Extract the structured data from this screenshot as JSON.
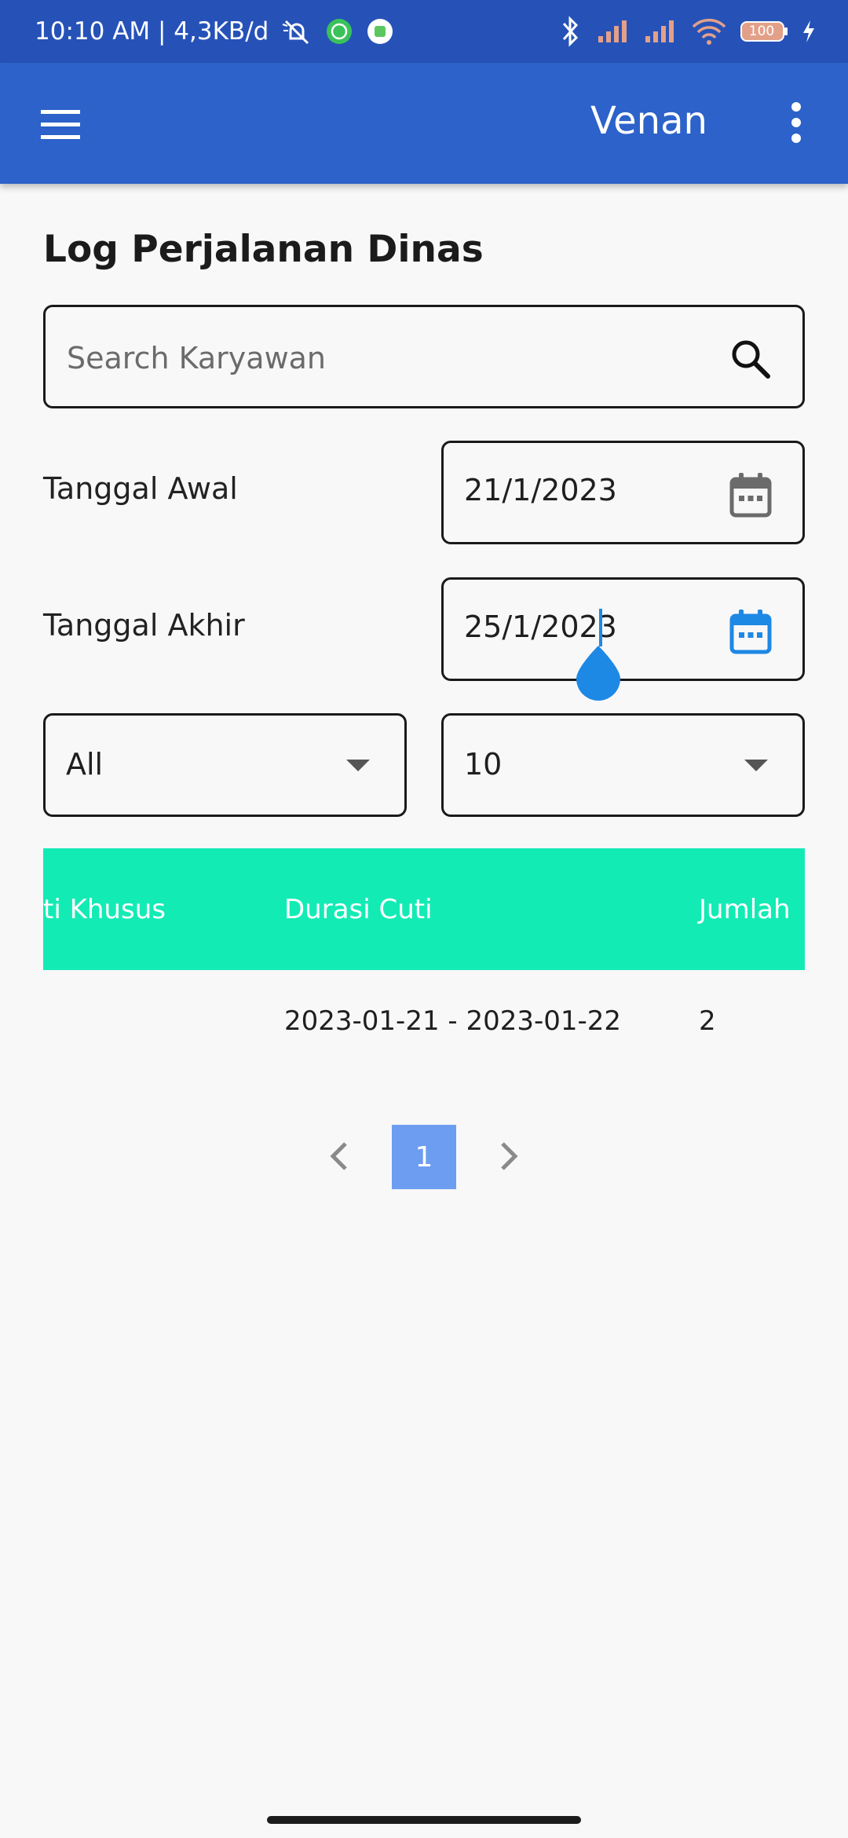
{
  "status_bar": {
    "left_text": "10:10 AM | 4,3KB/d",
    "battery_level": "100",
    "icons": [
      "mute-notifications-icon",
      "whatsapp-icon",
      "app-notification-icon",
      "bluetooth-icon",
      "signal-icon",
      "signal-icon",
      "wifi-icon",
      "battery-icon",
      "charging-icon"
    ]
  },
  "app_bar": {
    "title": "Venan",
    "left_icon": "menu-icon",
    "right_icon": "more-vert-icon",
    "color": "#2c62c9"
  },
  "page": {
    "title": "Log Perjalanan Dinas"
  },
  "search": {
    "placeholder": "Search Karyawan",
    "value": "",
    "icon": "search-icon"
  },
  "date_filters": {
    "start_label": "Tanggal Awal",
    "start_value": "21/1/2023",
    "end_label": "Tanggal Akhir",
    "end_value": "25/1/2023",
    "icon": "calendar-icon",
    "active_field": "end",
    "active_color": "#1e88e5"
  },
  "dropdowns": {
    "filter_value": "All",
    "page_size_value": "10"
  },
  "table": {
    "header_color": "#13ebb5",
    "columns": [
      "ti Khusus",
      "Durasi Cuti",
      "Jumlah"
    ],
    "rows": [
      [
        "",
        "2023-01-21 - 2023-01-22",
        "2"
      ]
    ]
  },
  "pagination": {
    "current_page": "1",
    "active_color": "#6d9df0"
  }
}
